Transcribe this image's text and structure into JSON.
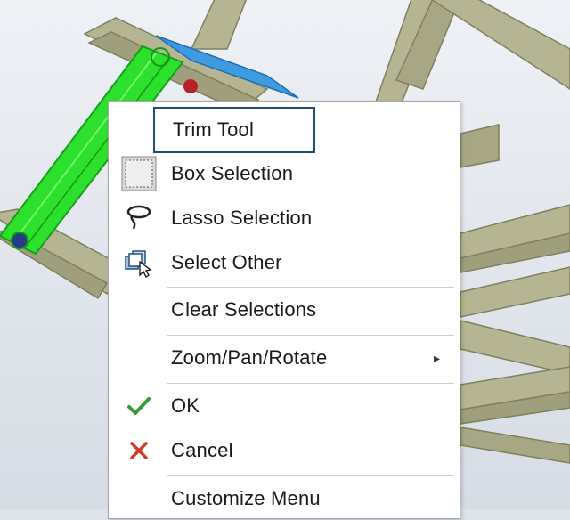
{
  "menu": {
    "items": [
      {
        "id": "trim_tool",
        "label": "Trim Tool",
        "icon": "none",
        "focused": true
      },
      {
        "id": "box_selection",
        "label": "Box Selection",
        "icon": "box-selection-icon"
      },
      {
        "id": "lasso_selection",
        "label": "Lasso Selection",
        "icon": "lasso-icon"
      },
      {
        "id": "select_other",
        "label": "Select Other",
        "icon": "select-other-icon"
      },
      {
        "id": "clear_selections",
        "label": "Clear Selections",
        "icon": "none"
      },
      {
        "id": "zoom_pan_rotate",
        "label": "Zoom/Pan/Rotate",
        "icon": "none",
        "submenu_indicator": "▸"
      },
      {
        "id": "ok",
        "label": "OK",
        "icon": "checkmark-icon"
      },
      {
        "id": "cancel",
        "label": "Cancel",
        "icon": "cross-icon"
      },
      {
        "id": "customize_menu",
        "label": "Customize Menu",
        "icon": "none"
      }
    ]
  },
  "colors": {
    "focus_border": "#1f4d7a",
    "ok_green": "#3a9a3a",
    "cancel_red": "#d33a2c",
    "selection_green": "#2ee02e",
    "member_olive": "#b5b594",
    "highlight_blue": "#3f9be0",
    "background": "#dfe4ea"
  }
}
